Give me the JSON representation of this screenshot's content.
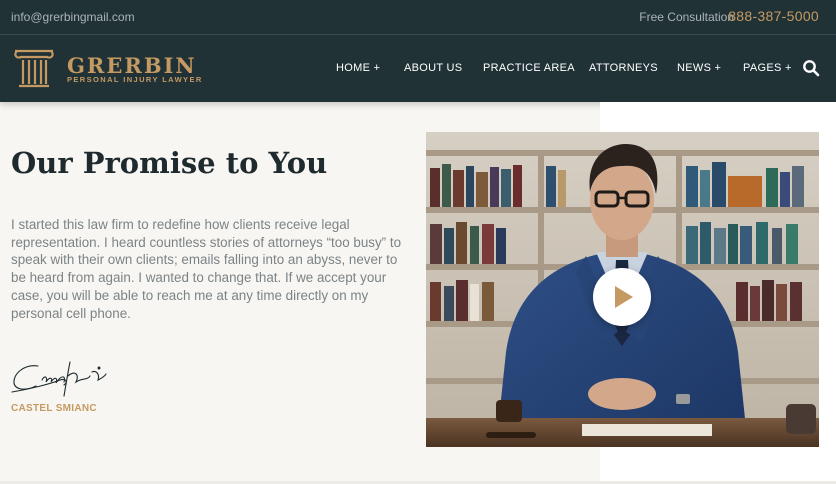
{
  "topbar": {
    "email": "info@grerbingmail.com",
    "consultation_label": "Free Consultation",
    "phone": "888-387-5000"
  },
  "brand": {
    "name": "GRERBIN",
    "tagline": "PERSONAL INJURY LAWYER",
    "color": "#c59a62"
  },
  "nav": {
    "items": [
      {
        "label": "HOME +"
      },
      {
        "label": "ABOUT US"
      },
      {
        "label": "PRACTICE AREA"
      },
      {
        "label": "ATTORNEYS"
      },
      {
        "label": "NEWS +"
      },
      {
        "label": "PAGES +"
      }
    ],
    "search_icon": "search-icon"
  },
  "promise": {
    "heading": "Our Promise to You",
    "body": "I started this law firm to redefine how clients receive legal representation. I heard countless stories of attorneys “too busy” to speak with their own clients; emails falling into an abyss, never to be heard from again. I wanted to change that. If we accept your case, you will be able to reach me at any time directly on my personal cell phone.",
    "signature_name": "CASTEL SMIANC"
  },
  "video": {
    "play_icon": "play-icon"
  },
  "colors": {
    "dark": "#213237",
    "accent": "#c59a62",
    "page_bg": "#f8f6f2",
    "heading": "#1e2a2e",
    "text": "#7b8386"
  }
}
